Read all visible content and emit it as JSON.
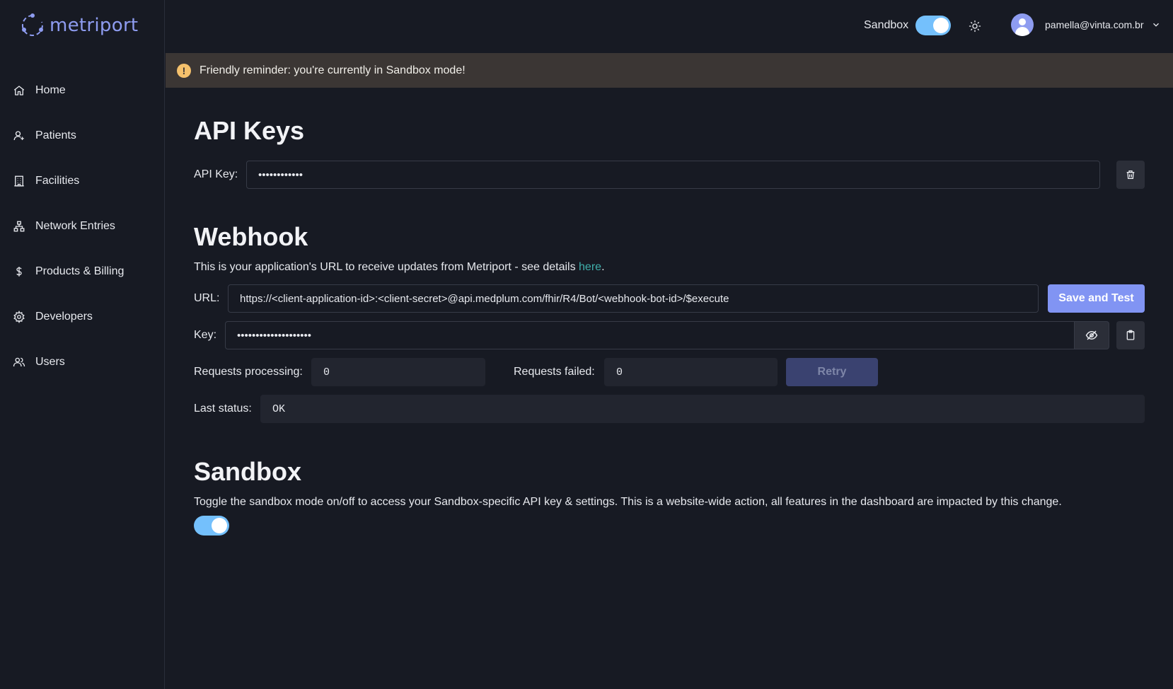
{
  "brand": {
    "name": "metriport"
  },
  "sidebar": {
    "items": [
      {
        "label": "Home",
        "icon": "home-icon"
      },
      {
        "label": "Patients",
        "icon": "patient-icon"
      },
      {
        "label": "Facilities",
        "icon": "building-icon"
      },
      {
        "label": "Network Entries",
        "icon": "network-icon"
      },
      {
        "label": "Products & Billing",
        "icon": "dollar-icon"
      },
      {
        "label": "Developers",
        "icon": "gear-icon"
      },
      {
        "label": "Users",
        "icon": "users-icon"
      }
    ]
  },
  "topbar": {
    "sandbox_label": "Sandbox",
    "sandbox_on": true,
    "user_email": "pamella@vinta.com.br"
  },
  "banner": {
    "text": "Friendly reminder: you're currently in Sandbox mode!"
  },
  "api_keys": {
    "title": "API Keys",
    "label": "API Key:",
    "value": "••••••••••••"
  },
  "webhook": {
    "title": "Webhook",
    "description_prefix": "This is your application's URL to receive updates from Metriport - see details ",
    "description_link": "here",
    "description_suffix": ".",
    "url_label": "URL:",
    "url_value": "https://<client-application-id>:<client-secret>@api.medplum.com/fhir/R4/Bot/<webhook-bot-id>/$execute",
    "save_label": "Save and Test",
    "key_label": "Key:",
    "key_value": "••••••••••••••••••••",
    "processing_label": "Requests processing:",
    "processing_value": "0",
    "failed_label": "Requests failed:",
    "failed_value": "0",
    "retry_label": "Retry",
    "last_status_label": "Last status:",
    "last_status_value": "OK"
  },
  "sandbox": {
    "title": "Sandbox",
    "description": "Toggle the sandbox mode on/off to access your Sandbox-specific API key & settings. This is a website-wide action, all features in the dashboard are impacted by this change.",
    "enabled": true
  },
  "colors": {
    "background": "#171a23",
    "accent": "#8194f3",
    "toggle": "#74c0fc",
    "banner": "#3b3634",
    "link": "#3fb0ac"
  }
}
